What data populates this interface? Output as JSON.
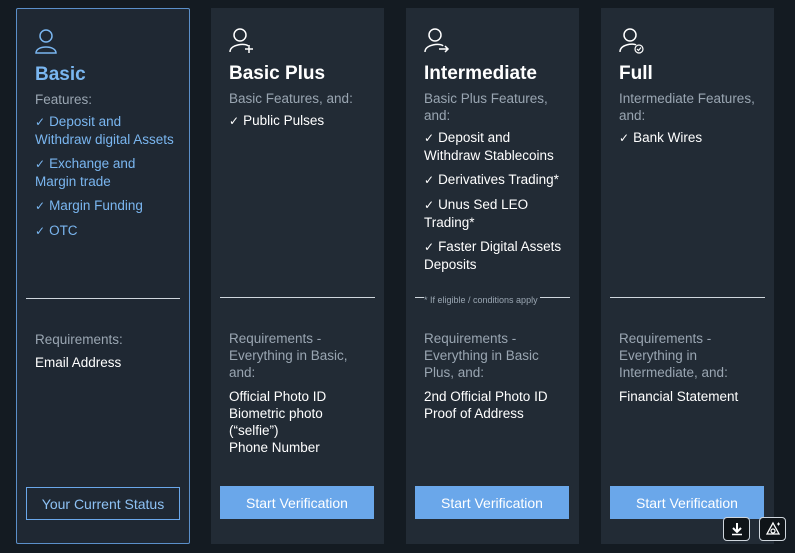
{
  "tiers": [
    {
      "title": "Basic",
      "icon": "user-icon",
      "features_label": "Features:",
      "features": [
        "Deposit and Withdraw digital Assets",
        "Exchange and Margin trade",
        "Margin Funding",
        "OTC"
      ],
      "requirements_label": "Requirements:",
      "requirements": [
        "Email Address"
      ],
      "button_label": "Your Current Status",
      "current": true
    },
    {
      "title": "Basic Plus",
      "icon": "user-add-icon",
      "features_label": "Basic Features, and:",
      "features": [
        "Public Pulses"
      ],
      "requirements_label": "Requirements - Everything in Basic, and:",
      "requirements": [
        "Official Photo ID",
        "Biometric photo (“selfie”)",
        "Phone Number"
      ],
      "button_label": "Start Verification",
      "current": false
    },
    {
      "title": "Intermediate",
      "icon": "user-arrow-icon",
      "features_label": "Basic Plus Features, and:",
      "features": [
        "Deposit and Withdraw Stablecoins",
        "Derivatives Trading*",
        "Unus Sed LEO Trading*",
        "Faster Digital Assets Deposits"
      ],
      "footnote": "* If eligible / conditions apply",
      "requirements_label": "Requirements - Everything in Basic Plus, and:",
      "requirements": [
        "2nd Official Photo ID",
        "Proof of Address"
      ],
      "button_label": "Start Verification",
      "current": false
    },
    {
      "title": "Full",
      "icon": "user-verified-icon",
      "features_label": "Intermediate Features, and:",
      "features": [
        "Bank Wires"
      ],
      "requirements_label": "Requirements - Everything in Intermediate, and:",
      "requirements": [
        "Financial Statement"
      ],
      "button_label": "Start Verification",
      "current": false
    }
  ],
  "floating": {
    "download_icon": "download-icon",
    "support_icon": "support-icon"
  },
  "colors": {
    "accent": "#6aa7ea",
    "card_bg": "#222b35",
    "page_bg": "#141b22",
    "current_border": "#5b8fc9"
  }
}
